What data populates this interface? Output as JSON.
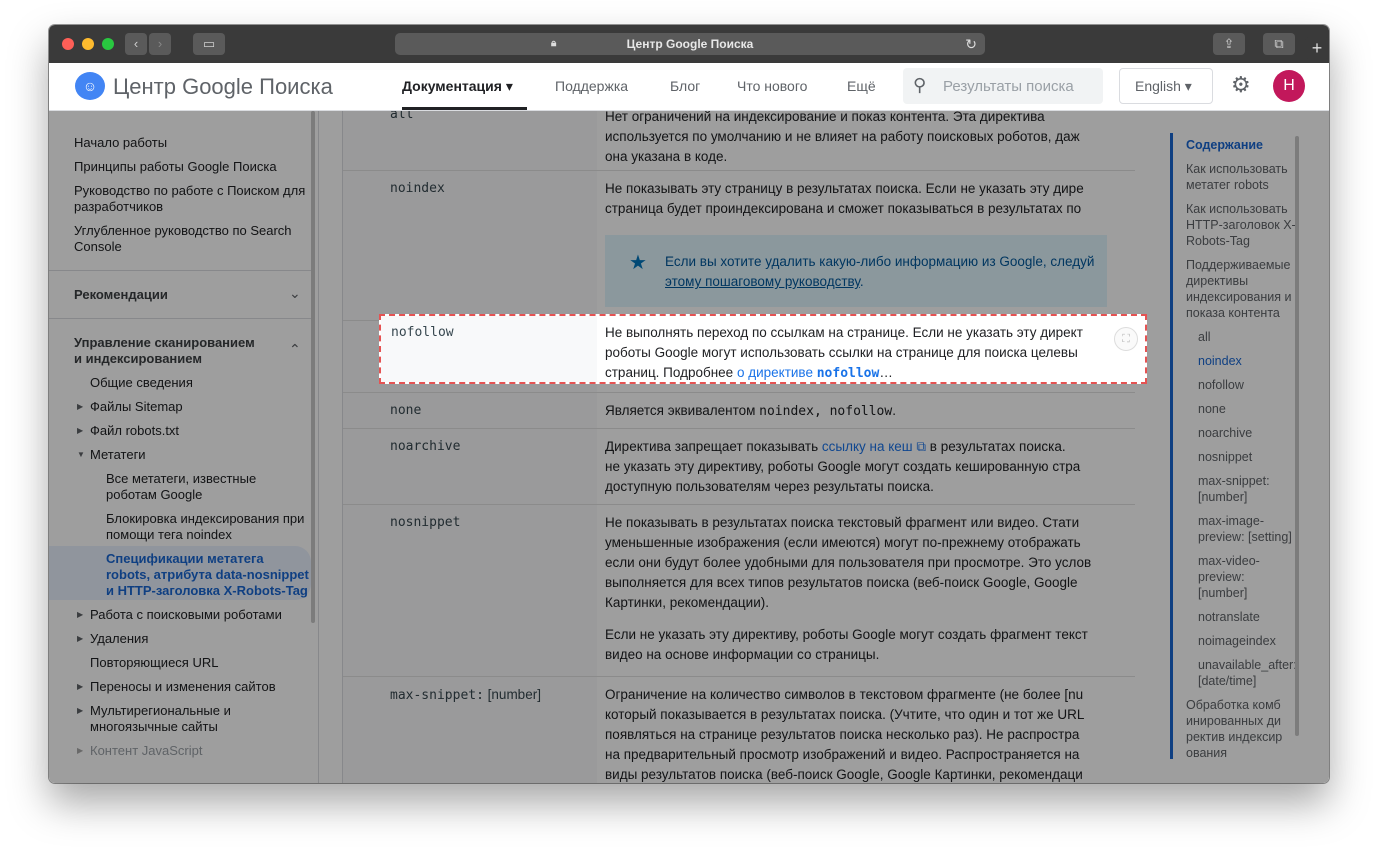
{
  "browser": {
    "url_title": "Центр Google Поиска"
  },
  "header": {
    "site_title": "Центр Google Поиска",
    "nav": [
      "Документация",
      "Поддержка",
      "Блог",
      "Что нового",
      "Ещё"
    ],
    "search_placeholder": "Результаты поиска",
    "language": "English",
    "avatar_letter": "H"
  },
  "sidebar": {
    "items": [
      "Начало работы",
      "Принципы работы Google Поиска",
      "Руководство по работе с Поиском для разработчиков",
      "Углубленное руководство по Search Console"
    ],
    "section_recommendations": "Рекомендации",
    "section_crawl": "Управление сканированием и индексированием",
    "crawl_items": [
      "Общие сведения",
      "Файлы Sitemap",
      "Файл robots.txt",
      "Метатеги"
    ],
    "meta_items": [
      "Все метатеги, известные роботам Google",
      "Блокировка индексирования при помощи тега noindex",
      "Спецификации метатега robots, атрибута data-nosnippet и HTTP-заголовка X-Robots-Tag"
    ],
    "more_items": [
      "Работа с поисковыми роботами",
      "Удаления",
      "Повторяющиеся URL",
      "Переносы и изменения сайтов",
      "Мультирегиональные и многоязычные сайты",
      "Контент JavaScript"
    ]
  },
  "table": {
    "all": {
      "code": "all",
      "lines": [
        "Нет ограничений на индексирование и показ контента. Эта директива",
        "используется по умолчанию и не влияет на работу поисковых роботов, даж",
        "она указана в коде."
      ]
    },
    "noindex": {
      "code": "noindex",
      "lines": [
        "Не показывать эту страницу в результатах поиска. Если не указать эту дире",
        "страница будет проиндексирована и сможет показываться в результатах по"
      ],
      "callout_line1": "Если вы хотите удалить какую-либо информацию из Google, следуй",
      "callout_link": "этому пошаговому руководству",
      "callout_end": "."
    },
    "nofollow": {
      "code": "nofollow",
      "lines": [
        "Не выполнять переход по ссылкам на странице. Если не указать эту директ",
        "роботы Google могут использовать ссылки на странице для поиска целевы"
      ],
      "line3_prefix": "страниц. Подробнее ",
      "line3_link": "о директиве ",
      "line3_code": "nofollow",
      "line3_suffix": "…"
    },
    "none": {
      "code": "none",
      "prefix": "Является эквивалентом ",
      "code_inline": "noindex, nofollow",
      "suffix": "."
    },
    "noarchive": {
      "code": "noarchive",
      "line1_prefix": "Директива запрещает показывать ",
      "line1_link": "ссылку на кеш",
      "line1_suffix": " в результатах поиска.",
      "lines": [
        "не указать эту директиву, роботы Google могут создать кешированную стра",
        "доступную пользователям через результаты поиска."
      ]
    },
    "nosnippet": {
      "code": "nosnippet",
      "lines": [
        "Не показывать в результатах поиска текстовый фрагмент или видео. Стати",
        "уменьшенные изображения (если имеются) могут по-прежнему отображать",
        "если они будут более удобными для пользователя при просмотре. Это услов",
        "выполняется для всех типов результатов поиска (веб-поиск Google, Google",
        "Картинки, рекомендации)."
      ],
      "para2": [
        "Если не указать эту директиву, роботы Google могут создать фрагмент текст",
        "видео на основе информации со страницы."
      ]
    },
    "max_snippet": {
      "code": "max-snippet:",
      "code_suffix": " [number]",
      "lines": [
        "Ограничение на количество символов в текстовом фрагменте (не более [nu",
        "который показывается в результатах поиска. (Учтите, что один и тот же URL",
        "появляться на странице результатов поиска несколько раз). Не распростра",
        "на предварительный просмотр изображений и видео. Распространяется на",
        "виды результатов поиска (веб-поиск Google, Google Картинки, рекомендаци"
      ]
    }
  },
  "toc": {
    "title": "Содержание",
    "items": [
      "Как использовать метатег robots",
      "Как использовать HTTP-заголовок X-Robots-Tag",
      "Поддерживаемые директивы индексирования и показа контента"
    ],
    "subitems": [
      "all",
      "noindex",
      "nofollow",
      "none",
      "noarchive",
      "nosnippet",
      "max-snippet: [number]",
      "max-image-preview: [setting]",
      "max-video-preview: [number]",
      "notranslate",
      "noimageindex",
      "unavailable_after: [date/time]"
    ],
    "last": "Обработка комбинированных директив индексирования"
  }
}
